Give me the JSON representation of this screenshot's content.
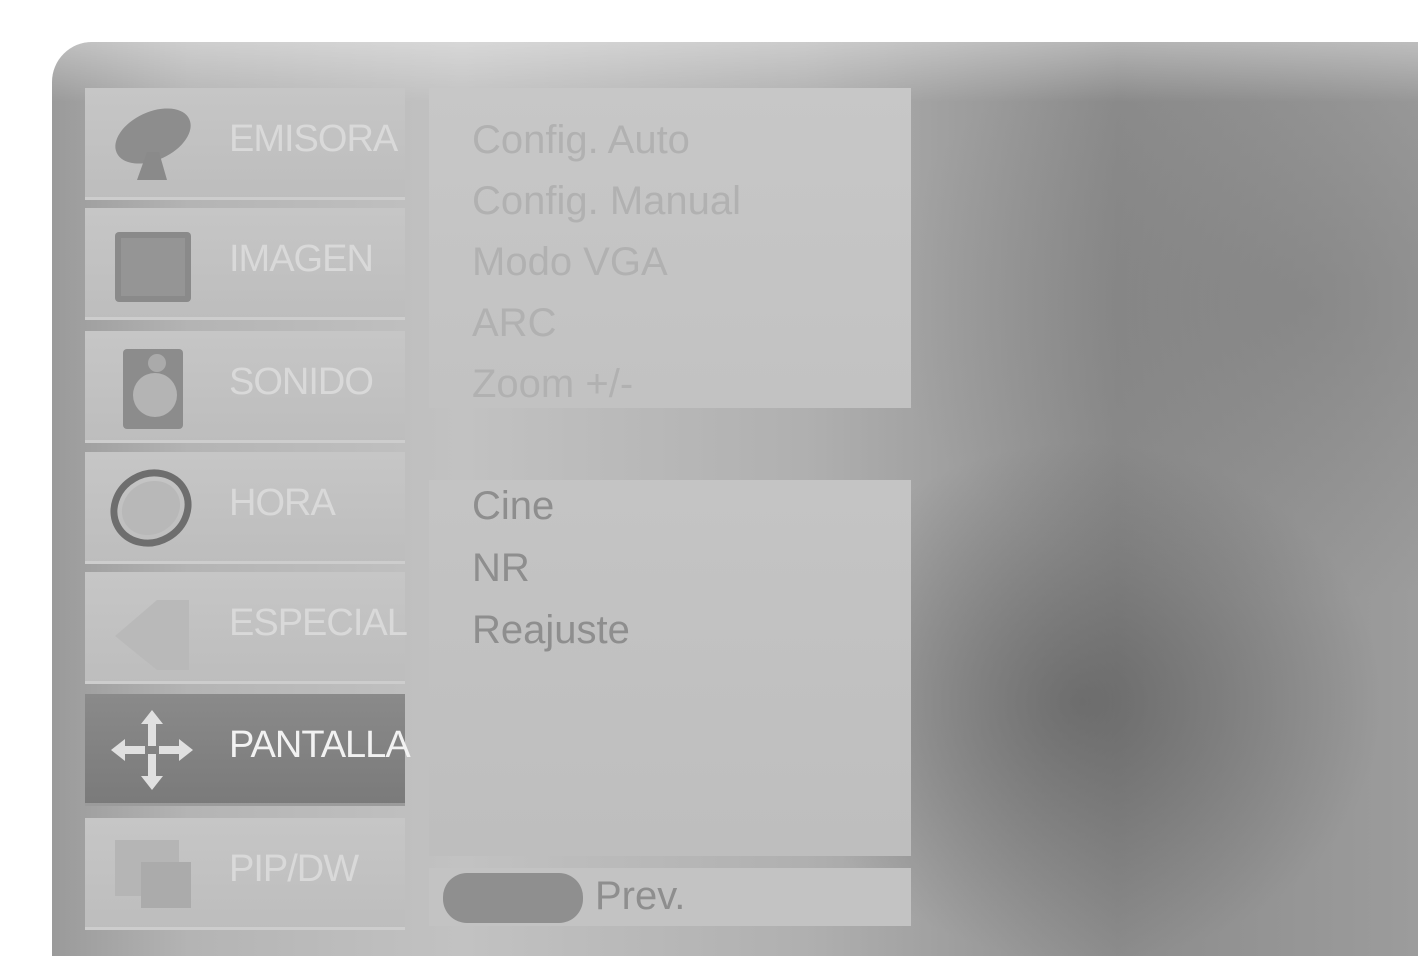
{
  "menu": {
    "items": [
      {
        "label": "EMISORA",
        "icon": "satellite-dish-icon"
      },
      {
        "label": "IMAGEN",
        "icon": "picture-icon"
      },
      {
        "label": "SONIDO",
        "icon": "speaker-icon"
      },
      {
        "label": "HORA",
        "icon": "clock-icon"
      },
      {
        "label": "ESPECIAL",
        "icon": "special-icon"
      },
      {
        "label": "PANTALLA",
        "icon": "screen-move-icon",
        "selected": true
      },
      {
        "label": "PIP/DW",
        "icon": "pip-icon"
      }
    ]
  },
  "submenu_top": {
    "options": [
      "Config. Auto",
      "Config. Manual",
      "Modo VGA",
      "ARC",
      "Zoom +/-"
    ]
  },
  "submenu_bottom": {
    "options": [
      "Cine",
      "NR",
      "Reajuste"
    ]
  },
  "footer": {
    "key_color": "blue-button",
    "label": "Prev."
  },
  "colors": {
    "panel": "#c3c3c3",
    "active_item": "#808080",
    "text_dim": "#b1b1b1",
    "text_lit": "#8e8e8e"
  }
}
